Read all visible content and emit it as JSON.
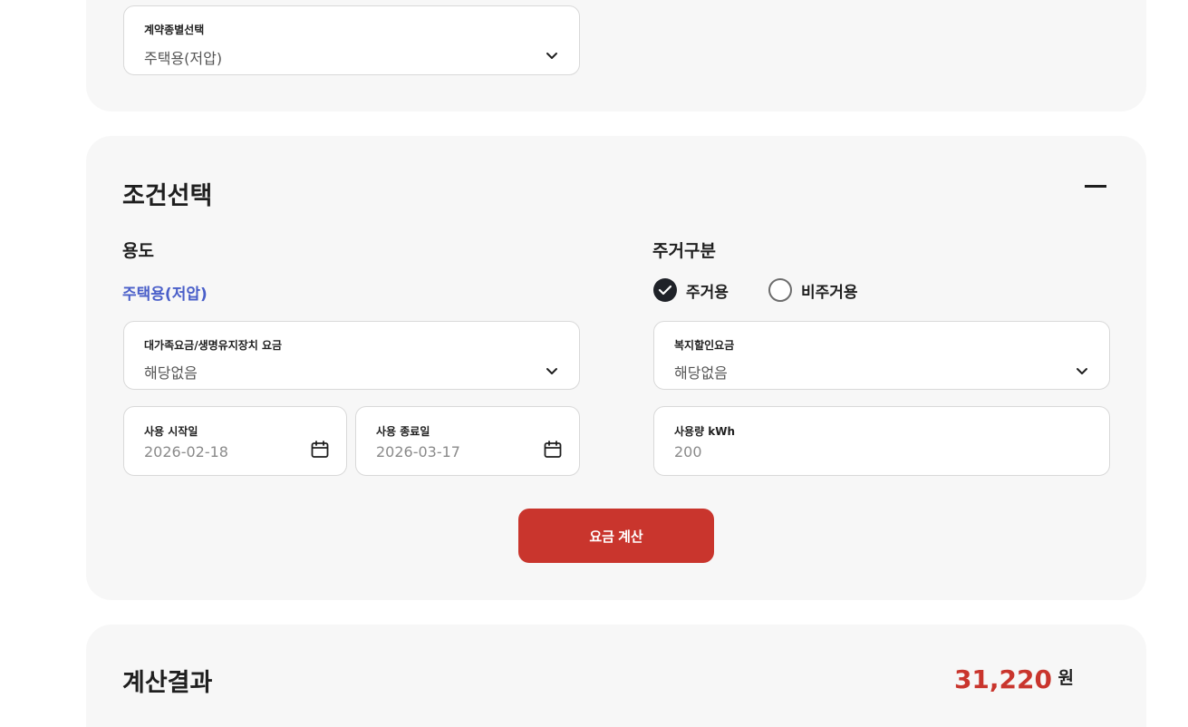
{
  "contract_type": {
    "label": "계약종별선택",
    "value": "주택용(저압)"
  },
  "conditions": {
    "title": "조건선택",
    "usage": {
      "label": "용도",
      "value": "주택용(저압)"
    },
    "residence": {
      "label": "주거구분",
      "options": [
        {
          "label": "주거용",
          "checked": true
        },
        {
          "label": "비주거용",
          "checked": false
        }
      ]
    },
    "big_family": {
      "label": "대가족요금/생명유지장치 요금",
      "value": "해당없음"
    },
    "welfare": {
      "label": "복지할인요금",
      "value": "해당없음"
    },
    "start_date": {
      "label": "사용 시작일",
      "value": "2026-02-18"
    },
    "end_date": {
      "label": "사용 종료일",
      "value": "2026-03-17"
    },
    "kwh": {
      "label": "사용량 kWh",
      "value": "200"
    },
    "calc_button": "요금 계산"
  },
  "result": {
    "title": "계산결과",
    "amount": "31,220",
    "unit": "원"
  },
  "colors": {
    "accent_red": "#c9352d",
    "link_blue": "#4a5fc9",
    "card_bg": "#f7f7f7"
  }
}
